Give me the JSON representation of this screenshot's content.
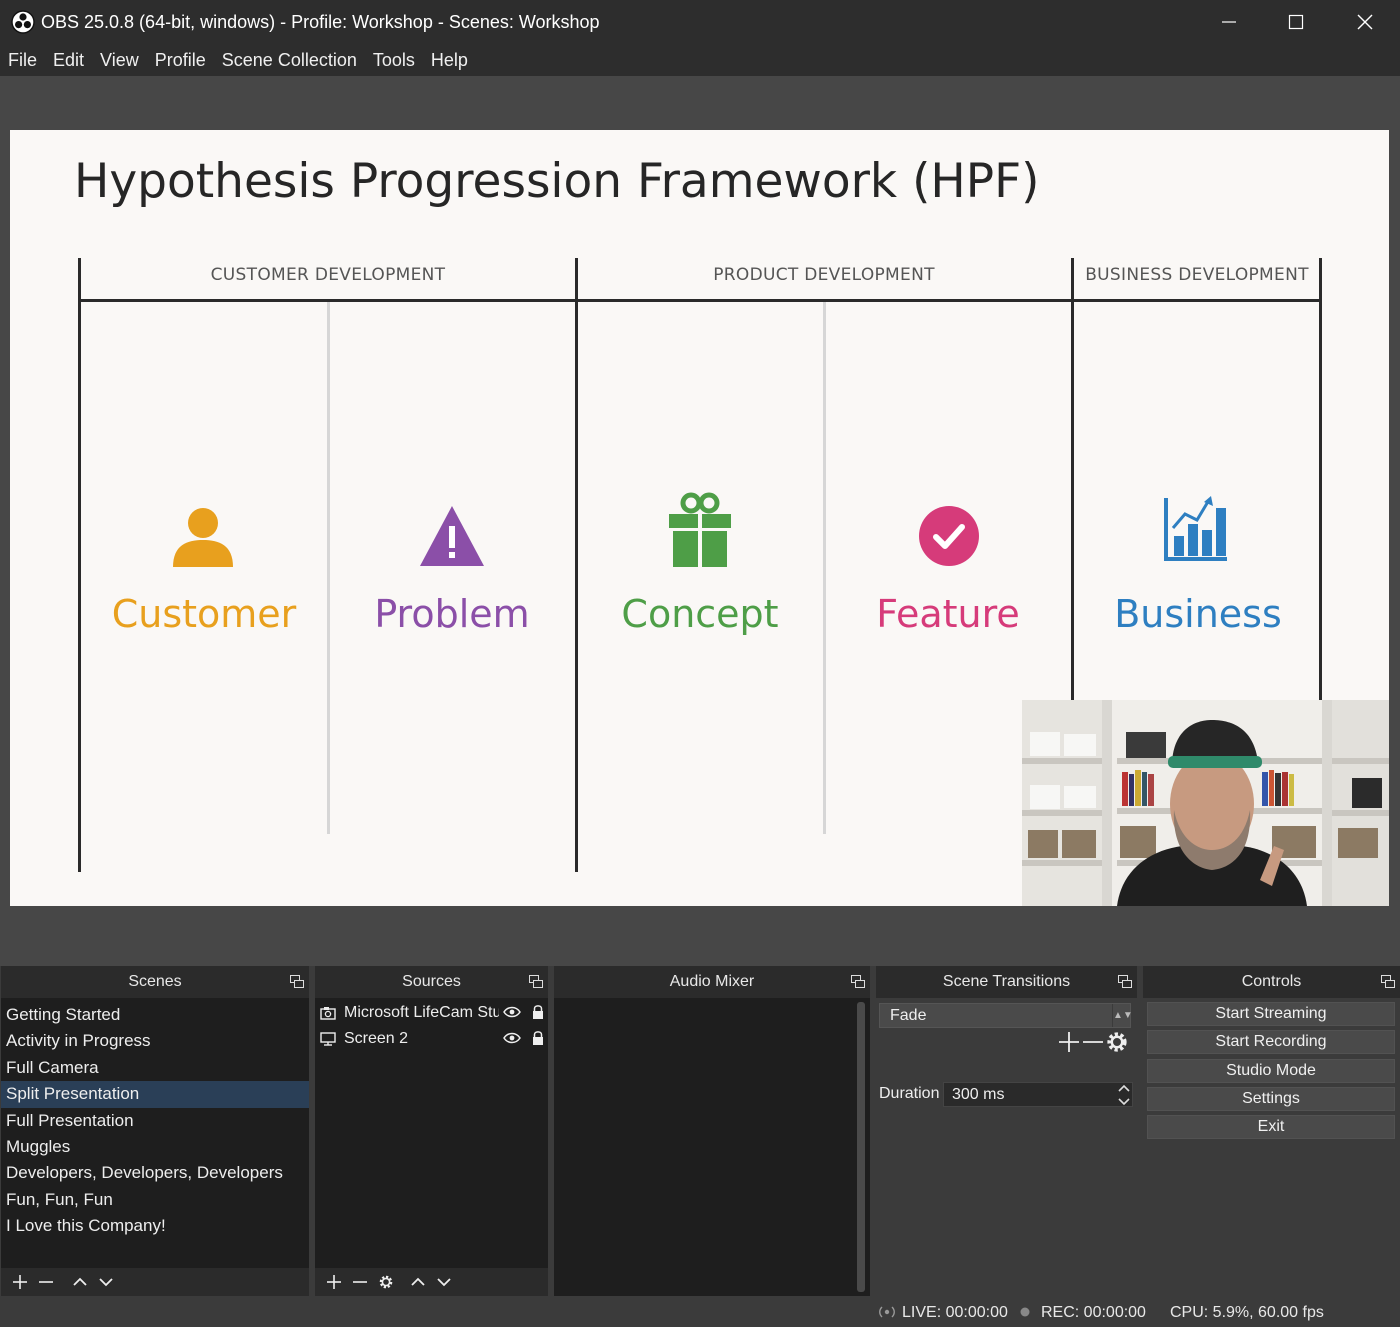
{
  "window": {
    "title": "OBS 25.0.8 (64-bit, windows) - Profile: Workshop - Scenes: Workshop"
  },
  "menu": [
    "File",
    "Edit",
    "View",
    "Profile",
    "Scene Collection",
    "Tools",
    "Help"
  ],
  "slide": {
    "title": "Hypothesis Progression Framework (HPF)",
    "sections": [
      "CUSTOMER DEVELOPMENT",
      "PRODUCT DEVELOPMENT",
      "BUSINESS DEVELOPMENT"
    ],
    "columns": [
      {
        "label": "Customer",
        "color": "#e8a01e",
        "icon": "person-icon"
      },
      {
        "label": "Problem",
        "color": "#8b4fa8",
        "icon": "warning-icon"
      },
      {
        "label": "Concept",
        "color": "#4e9e47",
        "icon": "gift-icon"
      },
      {
        "label": "Feature",
        "color": "#d63b7a",
        "icon": "checkmark-icon"
      },
      {
        "label": "Business",
        "color": "#2e7fc1",
        "icon": "bar-chart-icon"
      }
    ]
  },
  "docks": {
    "scenes": {
      "title": "Scenes",
      "items": [
        "Getting Started",
        "Activity in Progress",
        "Full Camera",
        "Split Presentation",
        "Full Presentation",
        "Muggles",
        "Developers, Developers, Developers",
        "Fun, Fun, Fun",
        "I Love this Company!"
      ],
      "selected": "Split Presentation"
    },
    "sources": {
      "title": "Sources",
      "items": [
        {
          "name": "Microsoft LifeCam Studio",
          "icon": "camera-icon"
        },
        {
          "name": "Screen 2",
          "icon": "monitor-icon"
        }
      ]
    },
    "audio_mixer": {
      "title": "Audio Mixer"
    },
    "transitions": {
      "title": "Scene Transitions",
      "selected": "Fade",
      "duration_label": "Duration",
      "duration_value": "300 ms"
    },
    "controls": {
      "title": "Controls",
      "buttons": [
        "Start Streaming",
        "Start Recording",
        "Studio Mode",
        "Settings",
        "Exit"
      ]
    }
  },
  "status": {
    "live": "LIVE: 00:00:00",
    "rec": "REC: 00:00:00",
    "cpu": "CPU: 5.9%, 60.00 fps"
  },
  "colors": {
    "accent_selected": "#2a3f57",
    "panel_bg": "#1e1e1e",
    "chrome_bg": "#2d2d2d"
  }
}
